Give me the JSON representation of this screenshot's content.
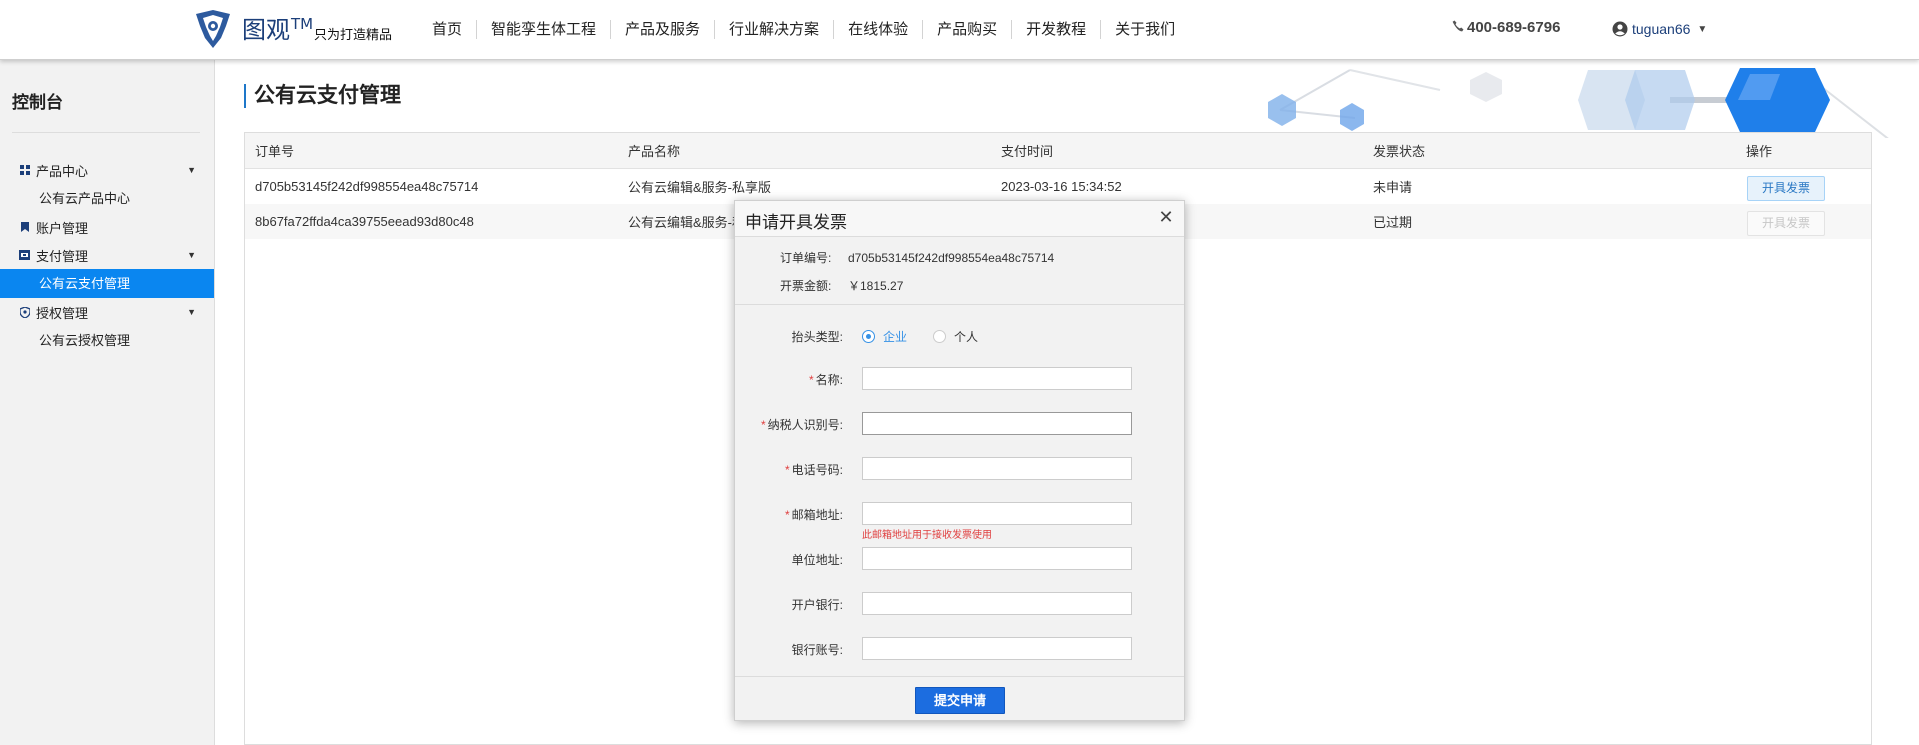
{
  "header": {
    "brand": "图观",
    "brand_tm": "TM",
    "slogan": "只为打造精品",
    "nav": [
      "首页",
      "智能孪生体工程",
      "产品及服务",
      "行业解决方案",
      "在线体验",
      "产品购买",
      "开发教程",
      "关于我们"
    ],
    "phone": "400-689-6796",
    "username": "tuguan66"
  },
  "sidebar": {
    "title": "控制台",
    "groups": [
      {
        "label": "产品中心",
        "icon": "grid-icon",
        "subs": [
          "公有云产品中心"
        ]
      },
      {
        "label": "账户管理",
        "icon": "bookmark-icon",
        "subs": []
      },
      {
        "label": "支付管理",
        "icon": "payment-icon",
        "subs": [
          "公有云支付管理"
        ]
      },
      {
        "label": "授权管理",
        "icon": "shield-icon",
        "subs": [
          "公有云授权管理"
        ]
      }
    ],
    "active": "公有云支付管理"
  },
  "main": {
    "title": "公有云支付管理",
    "columns": [
      "订单号",
      "产品名称",
      "支付时间",
      "发票状态",
      "操作"
    ],
    "rows": [
      {
        "order": "d705b53145f242df998554ea48c75714",
        "product": "公有云编辑&服务-私享版",
        "time": "2023-03-16 15:34:52",
        "status": "未申请",
        "action": "开具发票",
        "enabled": true
      },
      {
        "order": "8b67fa72ffda4ca39755eead93d80c48",
        "product": "公有云编辑&服务-私",
        "time": "",
        "status": "已过期",
        "action": "开具发票",
        "enabled": false
      }
    ]
  },
  "modal": {
    "title": "申请开具发票",
    "order_label": "订单编号:",
    "order_value": "d705b53145f242df998554ea48c75714",
    "amount_label": "开票金额:",
    "amount_value": "￥1815.27",
    "header_type_label": "抬头类型:",
    "header_type_options": [
      "企业",
      "个人"
    ],
    "header_type_selected": "企业",
    "fields": [
      {
        "label": "名称:",
        "required": true,
        "value": ""
      },
      {
        "label": "纳税人识别号:",
        "required": true,
        "value": ""
      },
      {
        "label": "电话号码:",
        "required": true,
        "value": ""
      },
      {
        "label": "邮箱地址:",
        "required": true,
        "value": ""
      },
      {
        "label": "单位地址:",
        "required": false,
        "value": ""
      },
      {
        "label": "开户银行:",
        "required": false,
        "value": ""
      },
      {
        "label": "银行账号:",
        "required": false,
        "value": ""
      }
    ],
    "email_hint": "此邮箱地址用于接收发票使用",
    "submit_label": "提交申请"
  },
  "colors": {
    "accent": "#0a86f0",
    "brand": "#1c3f7a",
    "submit": "#1c6de0",
    "required": "#e04040"
  }
}
